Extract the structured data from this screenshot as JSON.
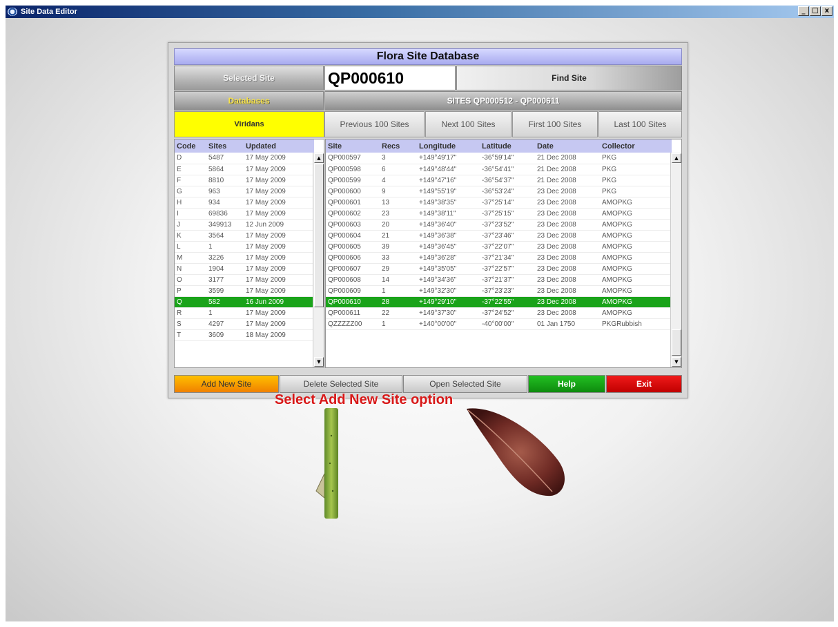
{
  "window": {
    "title": "Site Data Editor",
    "controls": [
      "_",
      "□",
      "x"
    ]
  },
  "panel": {
    "title": "Flora Site Database",
    "selected_site_label": "Selected Site",
    "selected_site_value": "QP000610",
    "find_site_label": "Find Site",
    "databases_label": "Databases",
    "sites_range_label": "SITES QP000512 - QP000611",
    "database_selected": "Viridans",
    "nav_buttons": [
      "Previous 100 Sites",
      "Next 100 Sites",
      "First 100 Sites",
      "Last 100 Sites"
    ]
  },
  "db_table": {
    "columns": [
      "Code",
      "Sites",
      "Updated"
    ],
    "rows": [
      [
        "D",
        "5487",
        "17 May 2009"
      ],
      [
        "E",
        "5864",
        "17 May 2009"
      ],
      [
        "F",
        "8810",
        "17 May 2009"
      ],
      [
        "G",
        "963",
        "17 May 2009"
      ],
      [
        "H",
        "934",
        "17 May 2009"
      ],
      [
        "I",
        "69836",
        "17 May 2009"
      ],
      [
        "J",
        "349913",
        "12 Jun 2009"
      ],
      [
        "K",
        "3564",
        "17 May 2009"
      ],
      [
        "L",
        "1",
        "17 May 2009"
      ],
      [
        "M",
        "3226",
        "17 May 2009"
      ],
      [
        "N",
        "1904",
        "17 May 2009"
      ],
      [
        "O",
        "3177",
        "17 May 2009"
      ],
      [
        "P",
        "3599",
        "17 May 2009"
      ],
      [
        "Q",
        "582",
        "16 Jun 2009"
      ],
      [
        "R",
        "1",
        "17 May 2009"
      ],
      [
        "S",
        "4297",
        "17 May 2009"
      ],
      [
        "T",
        "3609",
        "18 May 2009"
      ]
    ],
    "selected_index": 13
  },
  "site_table": {
    "columns": [
      "Site",
      "Recs",
      "Longitude",
      "Latitude",
      "Date",
      "Collector"
    ],
    "rows": [
      [
        "QP000597",
        "3",
        "+149°49'17\"",
        "-36°59'14\"",
        "21 Dec 2008",
        "PKG"
      ],
      [
        "QP000598",
        "6",
        "+149°48'44\"",
        "-36°54'41\"",
        "21 Dec 2008",
        "PKG"
      ],
      [
        "QP000599",
        "4",
        "+149°47'16\"",
        "-36°54'37\"",
        "21 Dec 2008",
        "PKG"
      ],
      [
        "QP000600",
        "9",
        "+149°55'19\"",
        "-36°53'24\"",
        "23 Dec 2008",
        "PKG"
      ],
      [
        "QP000601",
        "13",
        "+149°38'35\"",
        "-37°25'14\"",
        "23 Dec 2008",
        "AMOPKG"
      ],
      [
        "QP000602",
        "23",
        "+149°38'11\"",
        "-37°25'15\"",
        "23 Dec 2008",
        "AMOPKG"
      ],
      [
        "QP000603",
        "20",
        "+149°36'40\"",
        "-37°23'52\"",
        "23 Dec 2008",
        "AMOPKG"
      ],
      [
        "QP000604",
        "21",
        "+149°36'38\"",
        "-37°23'46\"",
        "23 Dec 2008",
        "AMOPKG"
      ],
      [
        "QP000605",
        "39",
        "+149°36'45\"",
        "-37°22'07\"",
        "23 Dec 2008",
        "AMOPKG"
      ],
      [
        "QP000606",
        "33",
        "+149°36'28\"",
        "-37°21'34\"",
        "23 Dec 2008",
        "AMOPKG"
      ],
      [
        "QP000607",
        "29",
        "+149°35'05\"",
        "-37°22'57\"",
        "23 Dec 2008",
        "AMOPKG"
      ],
      [
        "QP000608",
        "14",
        "+149°34'36\"",
        "-37°21'37\"",
        "23 Dec 2008",
        "AMOPKG"
      ],
      [
        "QP000609",
        "1",
        "+149°32'30\"",
        "-37°23'23\"",
        "23 Dec 2008",
        "AMOPKG"
      ],
      [
        "QP000610",
        "28",
        "+149°29'10\"",
        "-37°22'55\"",
        "23 Dec 2008",
        "AMOPKG"
      ],
      [
        "QP000611",
        "22",
        "+149°37'30\"",
        "-37°24'52\"",
        "23 Dec 2008",
        "AMOPKG"
      ],
      [
        "QZZZZZ00",
        "1",
        "+140°00'00\"",
        "-40°00'00\"",
        "01 Jan 1750",
        "PKGRubbish"
      ]
    ],
    "selected_index": 13
  },
  "actions": {
    "add_new_site": "Add New Site",
    "delete_selected_site": "Delete Selected Site",
    "open_selected_site": "Open Selected Site",
    "help": "Help",
    "exit": "Exit"
  },
  "caption": "Select Add New Site option",
  "colors": {
    "header_lavender": "#c6c8f2",
    "selection_green": "#1aa31a",
    "database_yellow": "#ffff00",
    "help_green": "#1aa31a",
    "exit_red": "#d41010",
    "add_orange": "#f5a300",
    "caption_red": "#d81818"
  }
}
